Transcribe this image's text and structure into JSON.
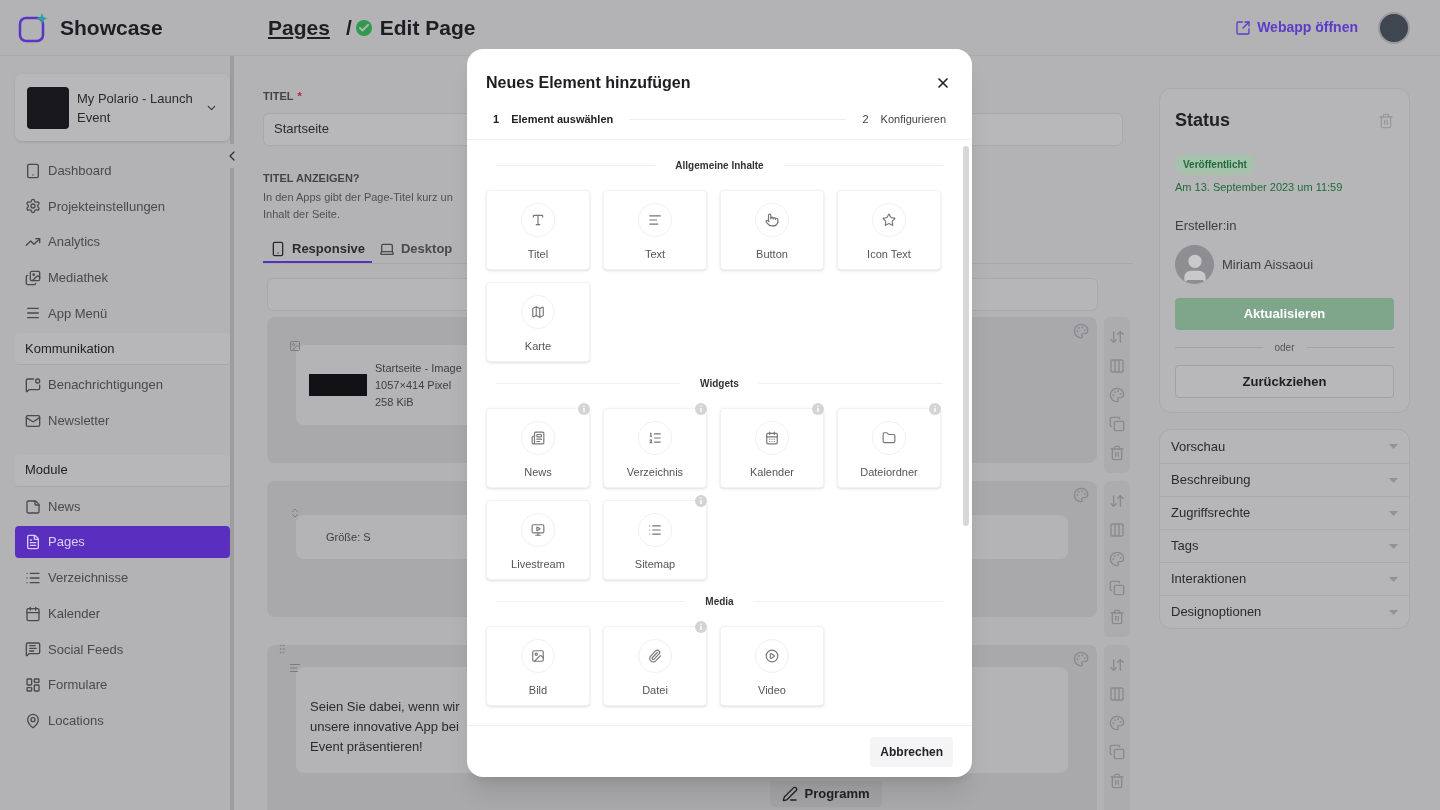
{
  "header": {
    "app_name": "Showcase",
    "breadcrumb": {
      "parent": "Pages",
      "separator": "/",
      "current": "Edit Page",
      "published": true
    },
    "webapp_link": "Webapp öffnen"
  },
  "sidebar": {
    "project": {
      "name": "My Polario - Launch Event"
    },
    "groups": [
      {
        "items": [
          {
            "label": "Dashboard",
            "selected": false
          },
          {
            "label": "Projekteinstellungen",
            "selected": false
          },
          {
            "label": "Analytics",
            "selected": false
          },
          {
            "label": "Mediathek",
            "selected": false
          },
          {
            "label": "App Menü",
            "selected": false
          }
        ]
      },
      {
        "heading": "Kommunikation",
        "items": [
          {
            "label": "Benachrichtigungen",
            "selected": false
          },
          {
            "label": "Newsletter",
            "selected": false
          }
        ]
      },
      {
        "heading": "Module",
        "items": [
          {
            "label": "News",
            "selected": false
          },
          {
            "label": "Pages",
            "selected": true
          },
          {
            "label": "Verzeichnisse",
            "selected": false
          },
          {
            "label": "Kalender",
            "selected": false
          },
          {
            "label": "Social Feeds",
            "selected": false
          },
          {
            "label": "Formulare",
            "selected": false
          },
          {
            "label": "Locations",
            "selected": false
          }
        ]
      }
    ]
  },
  "editor": {
    "title_label": "TITEL",
    "required": true,
    "required_mark": "*",
    "title_value": "Startseite",
    "show_title_label": "TITEL ANZEIGEN?",
    "show_title_help": [
      "In den Apps gibt der Page-Titel kurz un",
      "Inhalt der Seite."
    ],
    "tabs": [
      {
        "label": "Responsive",
        "selected": true
      },
      {
        "label": "Desktop",
        "selected": false
      }
    ],
    "blocks": [
      {
        "kind": "image",
        "title": "Startseite - Image",
        "dimensions": "1057×414 Pixel",
        "size": "258 KiB"
      },
      {
        "kind": "spacer",
        "label": "Größe: S"
      },
      {
        "kind": "text",
        "lines": [
          "Seien Sie dabei, wenn wir",
          "unsere innovative App bei",
          "Event präsentieren!"
        ],
        "button": "Programm"
      }
    ]
  },
  "status": {
    "title": "Status",
    "badge": "Veröffentlicht",
    "date": "Am 13. September 2023 um 11:59",
    "author_label": "Ersteller:in",
    "author": "Miriam Aissaoui",
    "update_button": {
      "label": "Aktualisieren",
      "disabled": true
    },
    "separator": "oder",
    "withdraw_button": "Zurückziehen"
  },
  "accordion": [
    {
      "label": "Vorschau",
      "expanded": false
    },
    {
      "label": "Beschreibung",
      "expanded": false
    },
    {
      "label": "Zugriffsrechte",
      "expanded": false
    },
    {
      "label": "Tags",
      "expanded": false
    },
    {
      "label": "Interaktionen",
      "expanded": false
    },
    {
      "label": "Designoptionen",
      "expanded": false
    }
  ],
  "modal": {
    "title": "Neues Element hinzufügen",
    "steps": [
      {
        "number": "1",
        "label": "Element auswählen",
        "selected": true
      },
      {
        "number": "2",
        "label": "Konfigurieren",
        "selected": false
      }
    ],
    "sections": [
      {
        "heading": "Allgemeine Inhalte",
        "items": [
          {
            "label": "Titel",
            "info": false
          },
          {
            "label": "Text",
            "info": false
          },
          {
            "label": "Button",
            "info": false
          },
          {
            "label": "Icon Text",
            "info": false
          },
          {
            "label": "Karte",
            "info": false
          }
        ]
      },
      {
        "heading": "Widgets",
        "items": [
          {
            "label": "News",
            "info": true
          },
          {
            "label": "Verzeichnis",
            "info": true
          },
          {
            "label": "Kalender",
            "info": true
          },
          {
            "label": "Dateiordner",
            "info": true
          },
          {
            "label": "Livestream",
            "info": false
          },
          {
            "label": "Sitemap",
            "info": true
          }
        ]
      },
      {
        "heading": "Media",
        "items": [
          {
            "label": "Bild",
            "info": false
          },
          {
            "label": "Datei",
            "info": true
          },
          {
            "label": "Video",
            "info": false
          }
        ]
      }
    ],
    "cancel_button": "Abbrechen"
  }
}
